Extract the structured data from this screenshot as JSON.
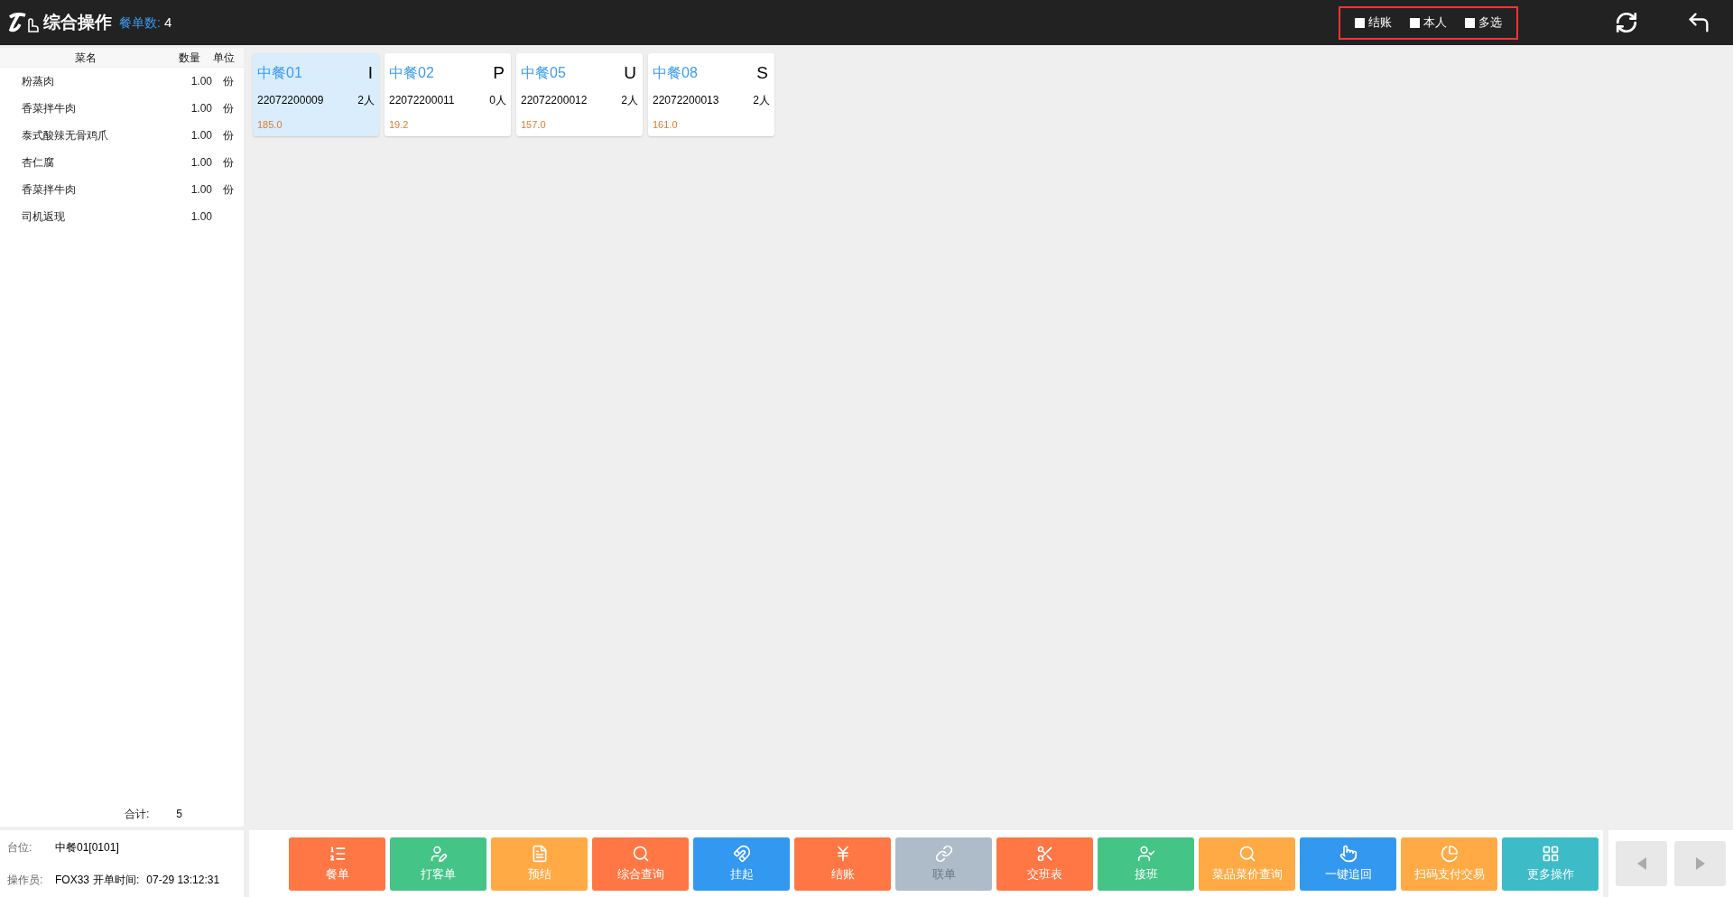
{
  "header": {
    "title": "综合操作",
    "order_count_label": "餐单数:",
    "order_count": "4"
  },
  "filters": [
    {
      "label": "结账",
      "checked": false
    },
    {
      "label": "本人",
      "checked": false
    },
    {
      "label": "多选",
      "checked": false
    }
  ],
  "dish_table": {
    "columns": [
      "菜名",
      "数量",
      "单位"
    ],
    "rows": [
      {
        "name": "粉蒸肉",
        "qty": "1.00",
        "unit": "份"
      },
      {
        "name": "香菜拌牛肉",
        "qty": "1.00",
        "unit": "份"
      },
      {
        "name": "泰式酸辣无骨鸡爪",
        "qty": "1.00",
        "unit": "份"
      },
      {
        "name": "杏仁腐",
        "qty": "1.00",
        "unit": "份"
      },
      {
        "name": "香菜拌牛肉",
        "qty": "1.00",
        "unit": "份"
      },
      {
        "name": "司机返现",
        "qty": "1.00"
      }
    ],
    "total_label": "合计:",
    "total": "5"
  },
  "tables": [
    {
      "name": "中餐01",
      "code": "I",
      "order_no": "22072200009",
      "guests": "2人",
      "amount": "185.0",
      "selected": true
    },
    {
      "name": "中餐02",
      "code": "P",
      "order_no": "22072200011",
      "guests": "0人",
      "amount": "19.2",
      "selected": false
    },
    {
      "name": "中餐05",
      "code": "U",
      "order_no": "22072200012",
      "guests": "2人",
      "amount": "157.0",
      "selected": false
    },
    {
      "name": "中餐08",
      "code": "S",
      "order_no": "22072200013",
      "guests": "2人",
      "amount": "161.0",
      "selected": false
    }
  ],
  "info": {
    "table_label": "台位:",
    "table_value": "中餐01[0101]",
    "operator_label": "操作员:",
    "operator_value": "FOX33",
    "open_time_label": "开单时间:",
    "open_time_value": "07-29 13:12:31"
  },
  "actions": [
    {
      "label": "餐单",
      "color": "#ff7744",
      "disabled": false
    },
    {
      "label": "打客单",
      "color": "#44c487",
      "disabled": false
    },
    {
      "label": "预结",
      "color": "#ffaa44",
      "disabled": false
    },
    {
      "label": "综合查询",
      "color": "#ff7744",
      "disabled": false
    },
    {
      "label": "挂起",
      "color": "#3399f0",
      "disabled": false
    },
    {
      "label": "结账",
      "color": "#ff7744",
      "disabled": false
    },
    {
      "label": "联单",
      "color": "#adbcc8",
      "disabled": true
    },
    {
      "label": "交班表",
      "color": "#ff7744",
      "disabled": false
    },
    {
      "label": "接班",
      "color": "#44c487",
      "disabled": false
    },
    {
      "label": "菜品菜价查询",
      "color": "#ffaa44",
      "disabled": false
    },
    {
      "label": "一键追回",
      "color": "#3399f0",
      "disabled": false
    },
    {
      "label": "扫码支付交易",
      "color": "#ffaa44",
      "disabled": false
    },
    {
      "label": "更多操作",
      "color": "#3dbcc8",
      "disabled": false
    }
  ]
}
